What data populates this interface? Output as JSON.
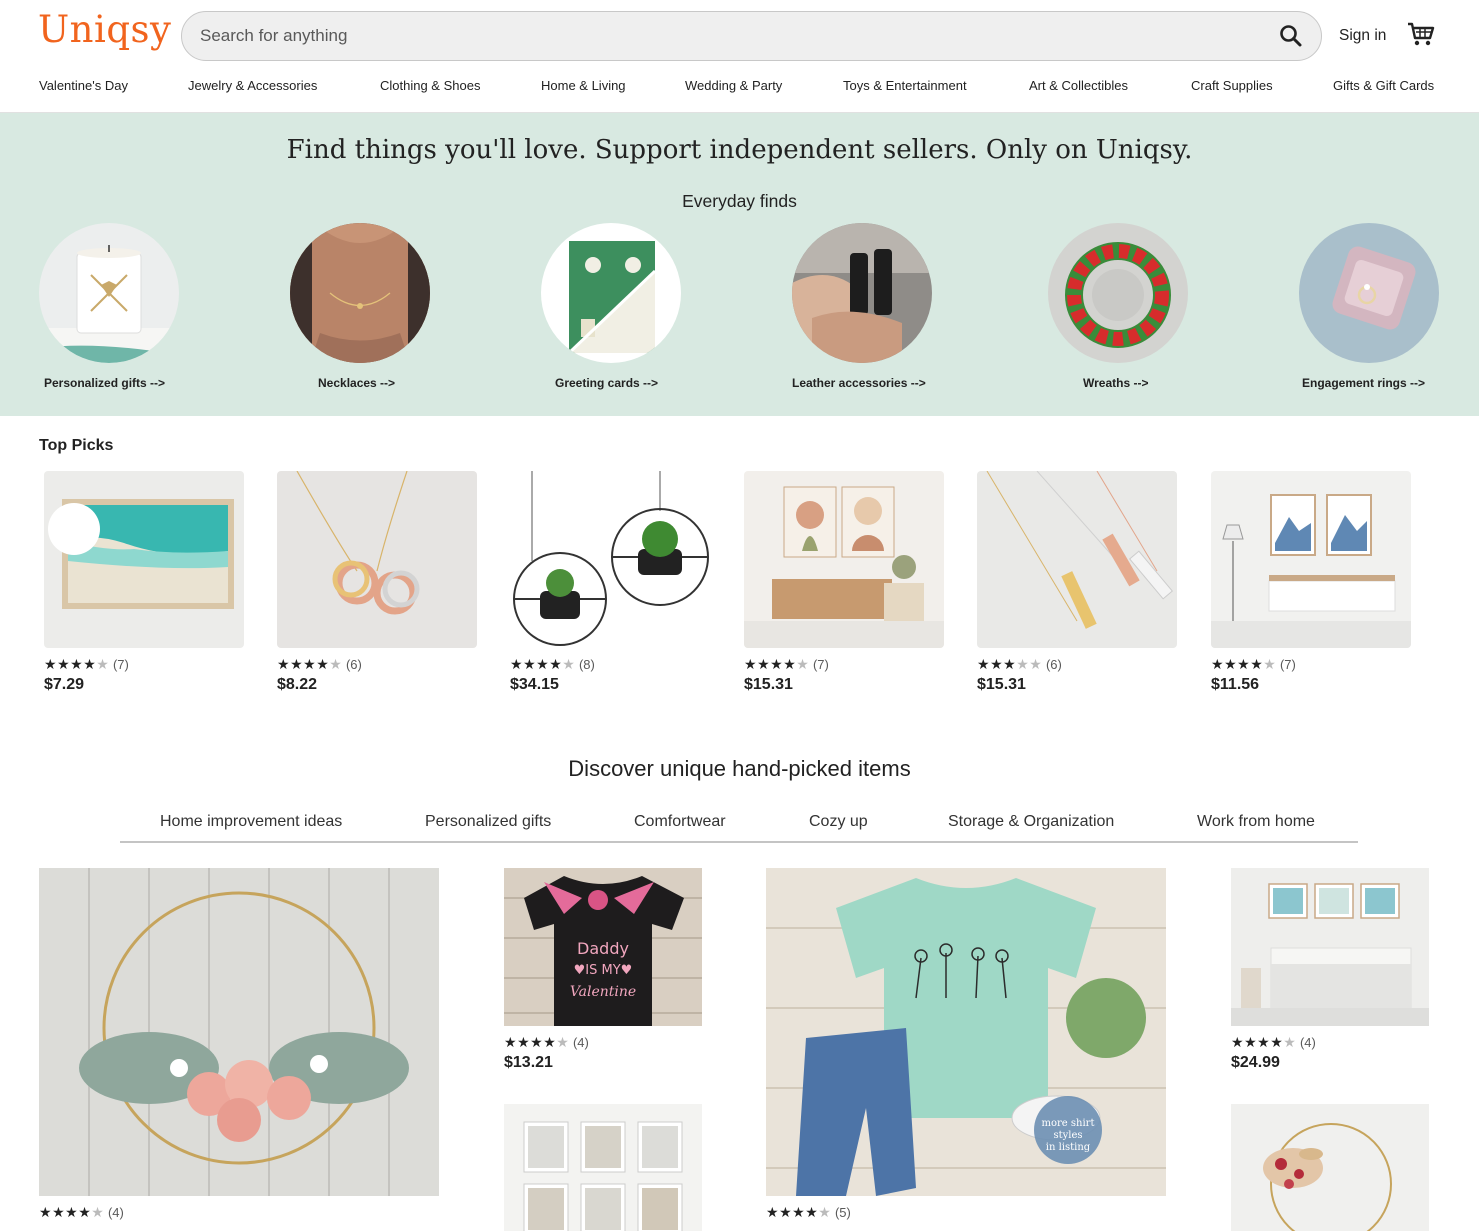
{
  "brand": {
    "logo": "Uniqsy",
    "accent": "#f1641e"
  },
  "header": {
    "search_placeholder": "Search for anything",
    "search_icon": "search-icon",
    "signin_label": "Sign in",
    "cart_icon": "cart-icon"
  },
  "categories": [
    "Valentine's Day",
    "Jewelry & Accessories",
    "Clothing & Shoes",
    "Home & Living",
    "Wedding & Party",
    "Toys & Entertainment",
    "Art & Collectibles",
    "Craft Supplies",
    "Gifts & Gift Cards"
  ],
  "hero": {
    "title": "Find things you'll love. Support independent sellers. Only on Uniqsy.",
    "subtitle": "Everyday finds",
    "background": "#d8e9e1",
    "items": [
      {
        "label": "Personalized gifts -->"
      },
      {
        "label": "Necklaces -->"
      },
      {
        "label": "Greeting cards -->"
      },
      {
        "label": "Leather accessories -->"
      },
      {
        "label": "Wreaths -->"
      },
      {
        "label": "Engagement rings -->"
      }
    ]
  },
  "top_picks": {
    "title": "Top Picks",
    "items": [
      {
        "rating": 4,
        "reviews": "(7)",
        "price": "$7.29"
      },
      {
        "rating": 4,
        "reviews": "(6)",
        "price": "$8.22"
      },
      {
        "rating": 4,
        "reviews": "(8)",
        "price": "$34.15"
      },
      {
        "rating": 4,
        "reviews": "(7)",
        "price": "$15.31"
      },
      {
        "rating": 3,
        "reviews": "(6)",
        "price": "$15.31"
      },
      {
        "rating": 4,
        "reviews": "(7)",
        "price": "$11.56"
      }
    ]
  },
  "discover": {
    "title": "Discover unique hand-picked items",
    "tabs": [
      "Home improvement ideas",
      "Personalized gifts",
      "Comfortwear",
      "Cozy up",
      "Storage & Organization",
      "Work from home"
    ],
    "items": [
      {
        "rating": 4,
        "reviews": "(4)",
        "price": ""
      },
      {
        "rating": 4,
        "reviews": "(4)",
        "price": "$13.21"
      },
      {
        "rating": 4,
        "reviews": "(5)",
        "price": ""
      },
      {
        "rating": 4,
        "reviews": "(4)",
        "price": "$24.99"
      }
    ]
  }
}
